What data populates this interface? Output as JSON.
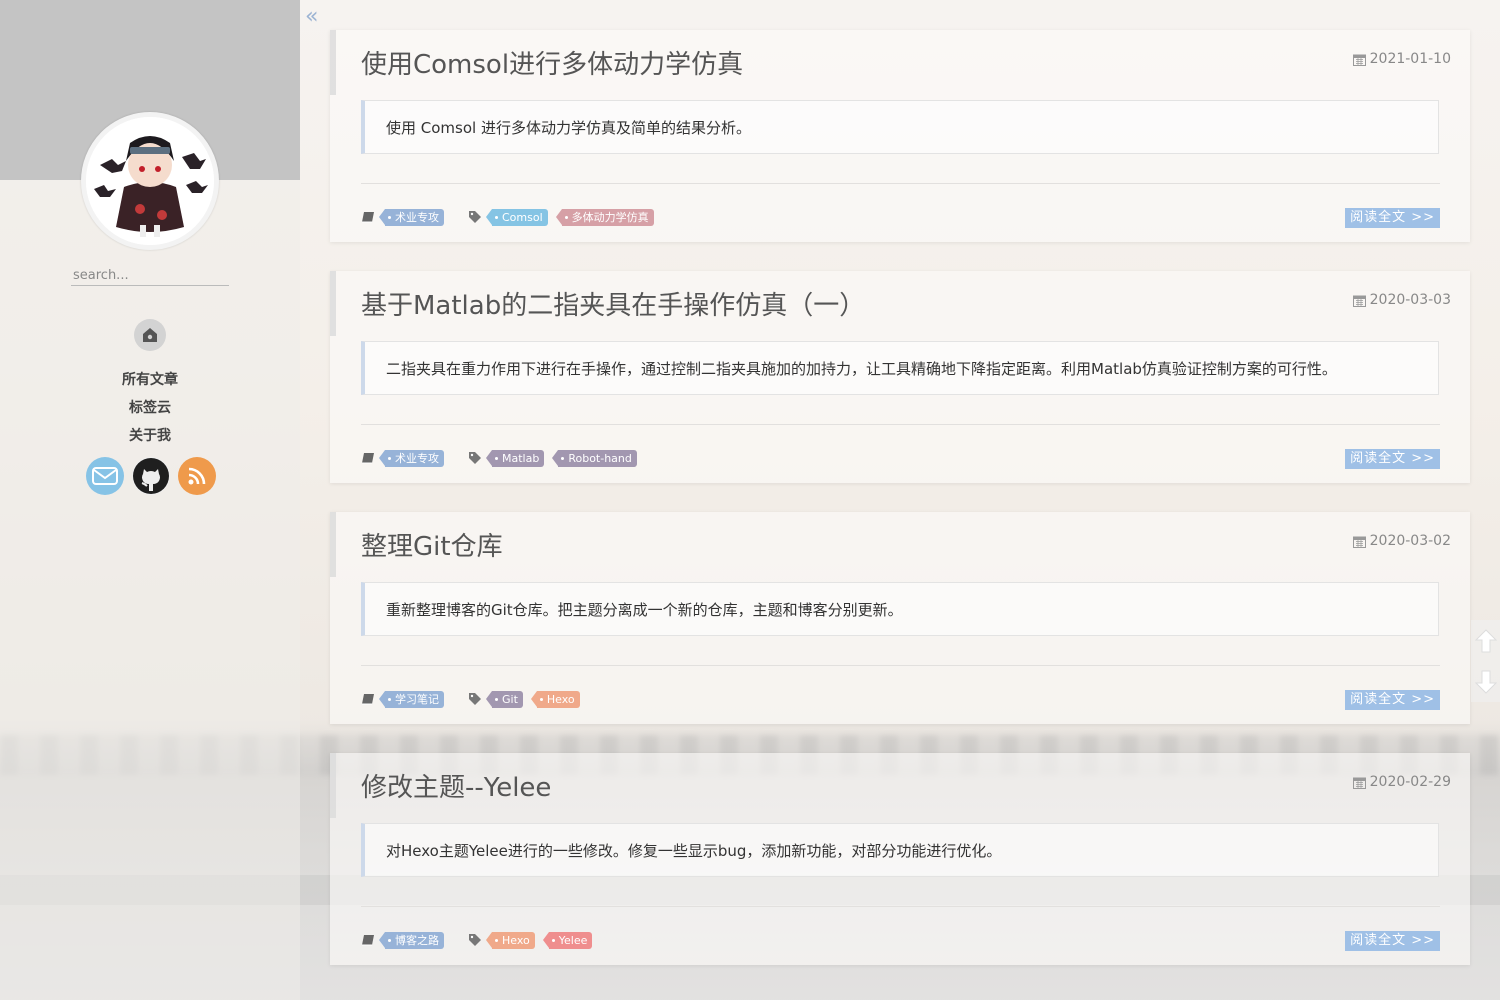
{
  "sidebar": {
    "search_placeholder": "search...",
    "nav": [
      "所有文章",
      "标签云",
      "关于我"
    ],
    "social": [
      "mail-icon",
      "github-icon",
      "rss-icon"
    ]
  },
  "collapse_label": "«",
  "posts": [
    {
      "title": "使用Comsol进行多体动力学仿真",
      "date": "2021-01-10",
      "excerpt": "使用 Comsol 进行多体动力学仿真及简单的结果分析。",
      "category": "术业专攻",
      "tags": [
        "Comsol",
        "多体动力学仿真"
      ],
      "read_more": "阅读全文 >>"
    },
    {
      "title": "基于Matlab的二指夹具在手操作仿真（一）",
      "date": "2020-03-03",
      "excerpt": "二指夹具在重力作用下进行在手操作，通过控制二指夹具施加的加持力，让工具精确地下降指定距离。利用Matlab仿真验证控制方案的可行性。",
      "category": "术业专攻",
      "tags": [
        "Matlab",
        "Robot-hand"
      ],
      "read_more": "阅读全文 >>"
    },
    {
      "title": "整理Git仓库",
      "date": "2020-03-02",
      "excerpt": "重新整理博客的Git仓库。把主题分离成一个新的仓库，主题和博客分别更新。",
      "category": "学习笔记",
      "tags": [
        "Git",
        "Hexo"
      ],
      "read_more": "阅读全文 >>"
    },
    {
      "title": "修改主题--Yelee",
      "date": "2020-02-29",
      "excerpt": "对Hexo主题Yelee进行的一些修改。修复一些显示bug，添加新功能，对部分功能进行优化。",
      "category": "博客之路",
      "tags": [
        "Hexo",
        "Yelee"
      ],
      "read_more": "阅读全文 >>"
    }
  ]
}
